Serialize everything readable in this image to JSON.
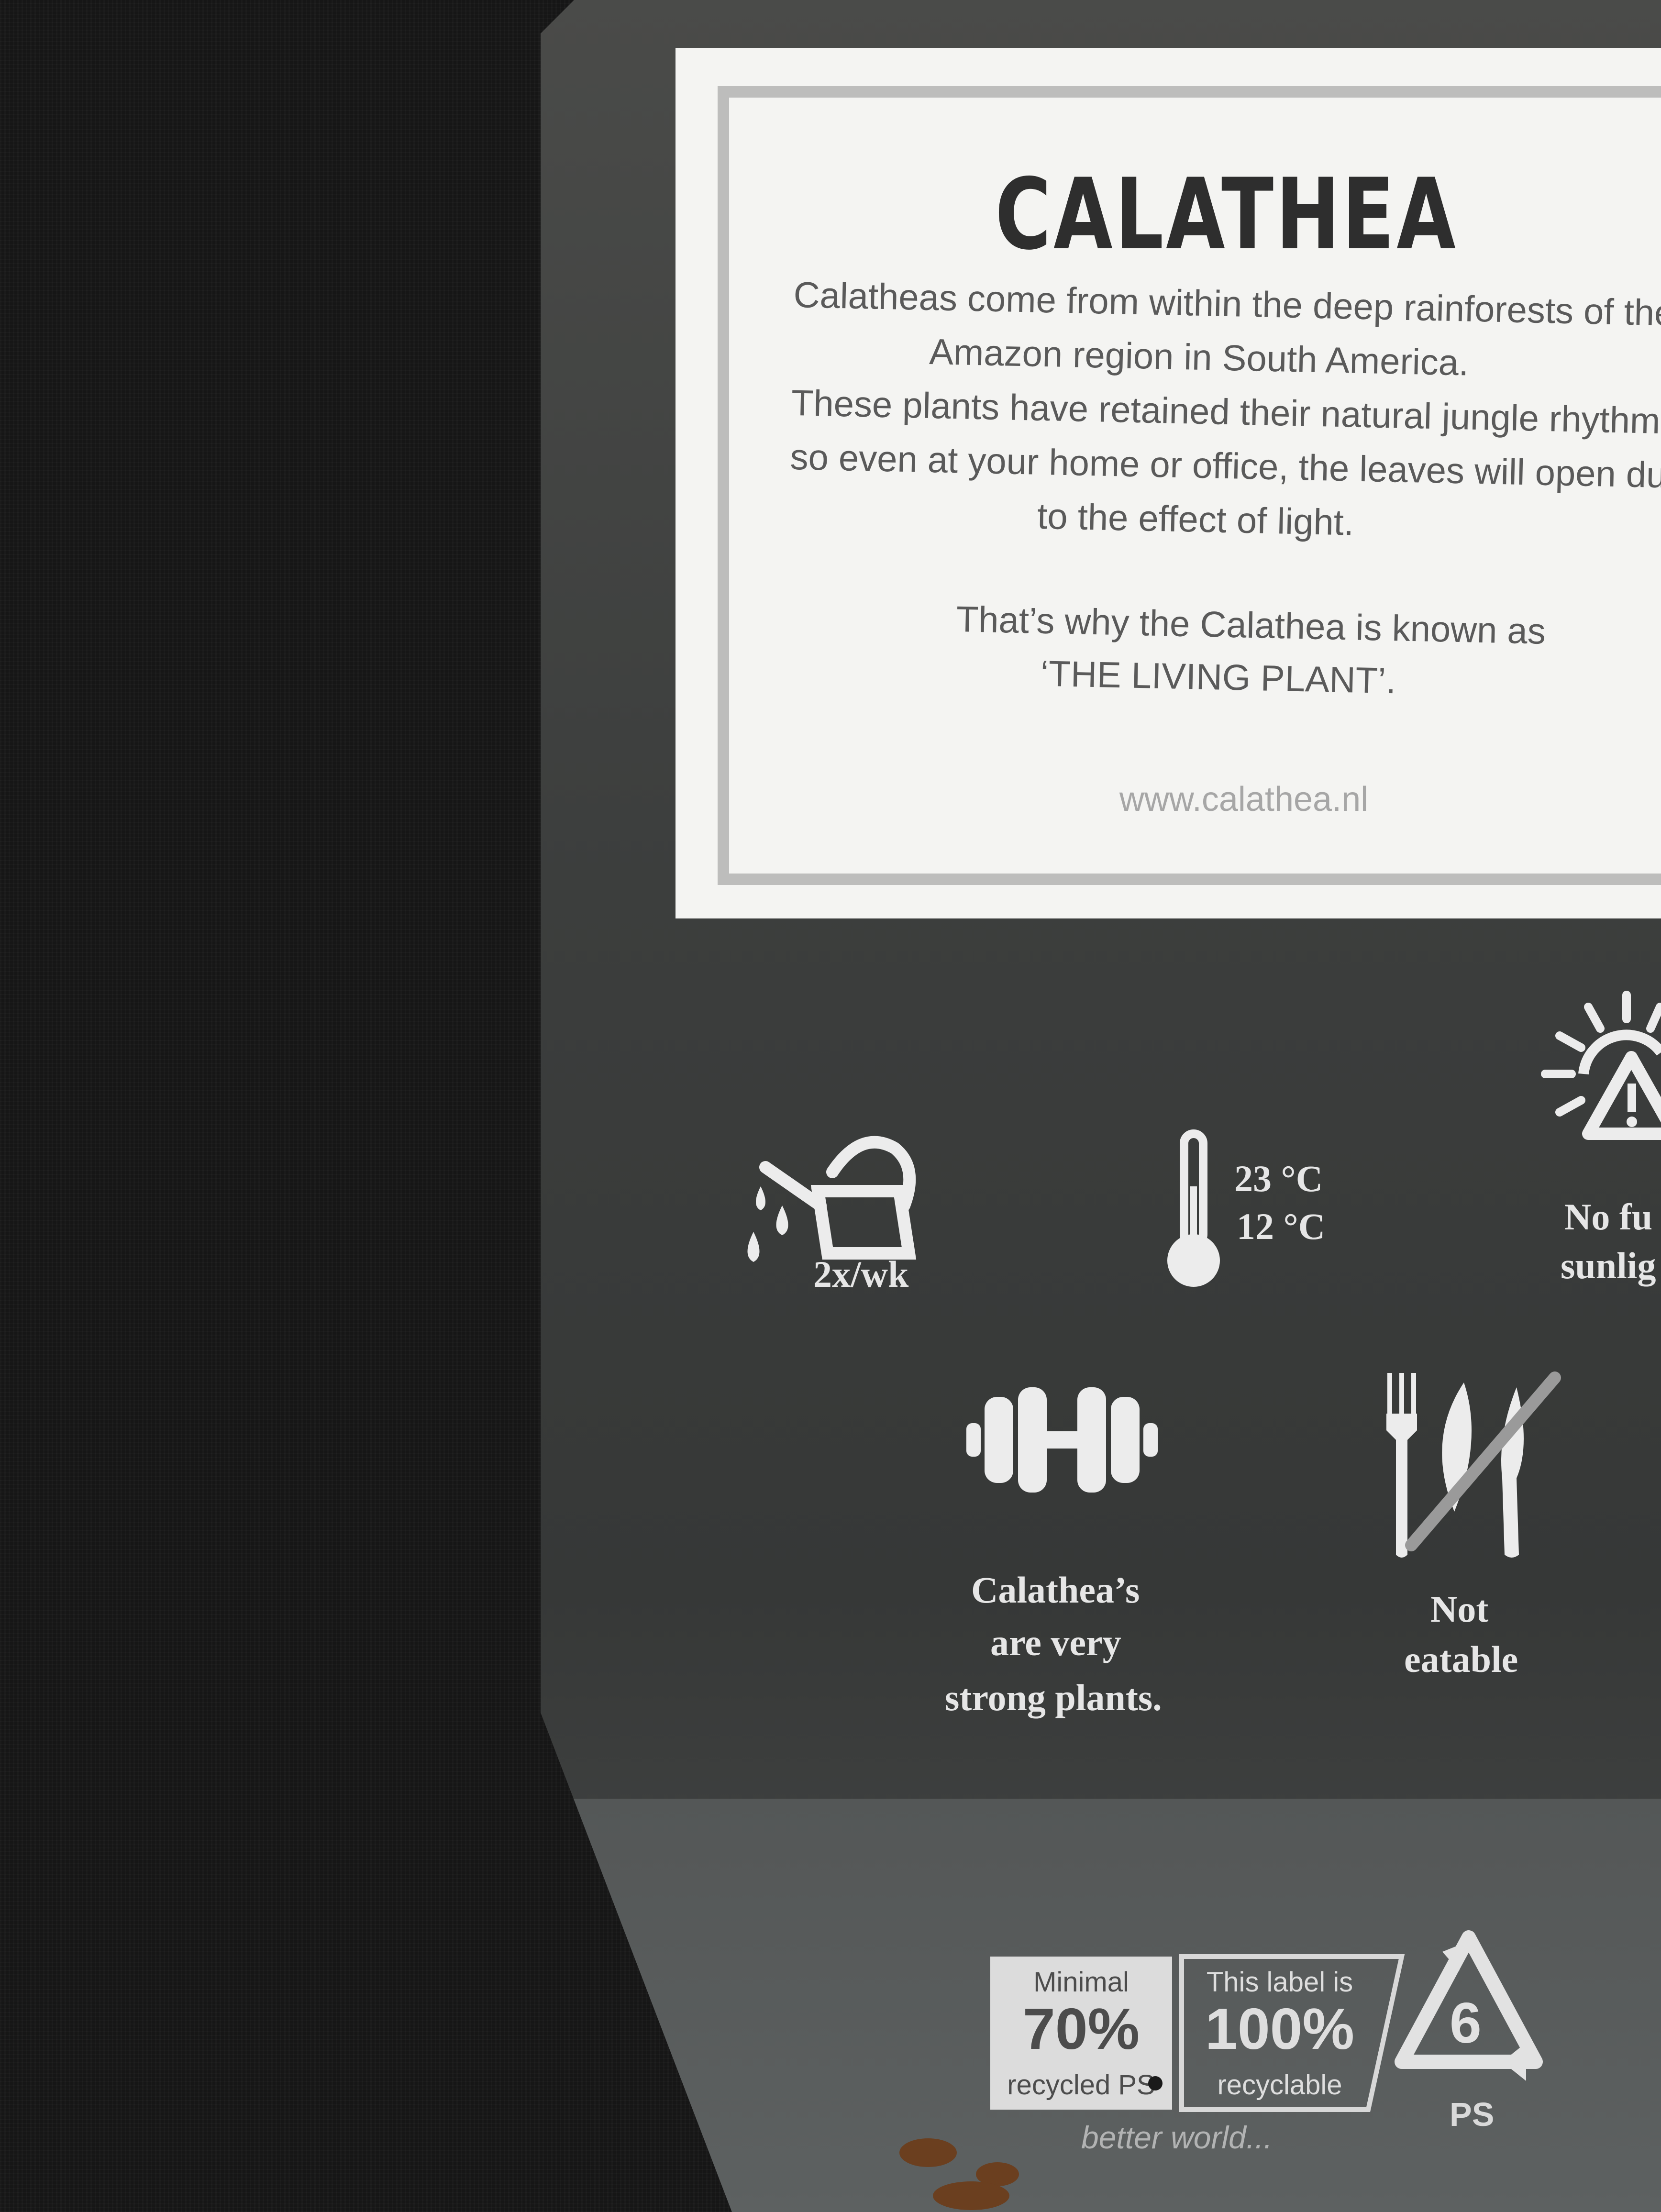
{
  "label": {
    "title": "CALATHEA",
    "paragraph_lines": [
      "Calatheas come from within the deep rainforests of the",
      "Amazon region in South America.",
      "These plants have retained their natural jungle rhythm,",
      "so even at your home or office, the leaves will open due",
      "to the effect of light."
    ],
    "quote_lines": [
      "That’s why the Calathea is known as",
      "‘THE LIVING PLANT’."
    ],
    "url": "www.calathea.nl"
  },
  "care": {
    "water": {
      "icon": "watering-can-icon",
      "text": "2x/wk"
    },
    "temperature": {
      "icon": "thermometer-icon",
      "max": "23 °C",
      "min": "12 °C"
    },
    "sunlight": {
      "icon": "sun-warning-icon",
      "line1": "No fu",
      "line2": "sunlig"
    },
    "strength": {
      "icon": "dumbbell-icon",
      "lines": [
        "Calathea’s",
        "are very",
        "strong plants."
      ]
    },
    "edible": {
      "icon": "not-edible-icon",
      "lines": [
        "Not",
        "eatable"
      ]
    }
  },
  "recycling": {
    "recycled": {
      "top": "Minimal",
      "value": "70%",
      "bottom": "recycled PS"
    },
    "recyclable": {
      "top": "This label is",
      "value": "100%",
      "bottom": "recyclable"
    },
    "code": "6",
    "material": "PS",
    "footer": "better world..."
  },
  "colors": {
    "fabric": "#161616",
    "tag": "#3c3e3d",
    "card": "#f4f4f2",
    "ink": "#5a5a5a",
    "icon": "#ececec"
  }
}
